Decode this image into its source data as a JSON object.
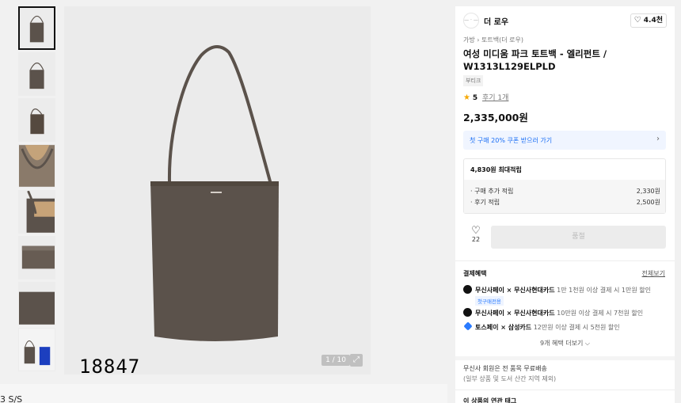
{
  "gallery": {
    "counter": "1 / 10",
    "expand_icon": "expand-icon",
    "watermark": "18847",
    "thumbnail_count": 8,
    "bag_color": "#5b524b"
  },
  "footer_strip": {
    "text": "3 S/S"
  },
  "brand": {
    "logo_text": "— · —",
    "name": "더 로우",
    "like_icon": "heart-icon",
    "like_count": "4.4천"
  },
  "product": {
    "breadcrumb": "가방 › 토트백(더 로우)",
    "title": "여성 미디움 파크 토트백 - 엘리펀트 / W1313L129ELPLD",
    "tag": "부티크",
    "rating_score": "5",
    "rating_reviews": "후기 1개",
    "price": "2,335,000원"
  },
  "coupon": {
    "label": "첫 구매 20% 쿠폰 받으러 가기",
    "chevron_icon": "chevron-right-icon"
  },
  "points": {
    "title": "4,830원 최대적립",
    "rows": [
      {
        "label": "· 구매 추가 적립",
        "value": "2,330원"
      },
      {
        "label": "· 후기 적립",
        "value": "2,500원"
      }
    ]
  },
  "purchase": {
    "wish_count": "22",
    "buy_label": "품절"
  },
  "benefits": {
    "title": "결제혜택",
    "view_all": "전체보기",
    "items": [
      {
        "strong": "무신사페이 × 무신사현대카드",
        "desc": " 1만 1천원 이상 결제 시 1만원 할인",
        "badge": "첫구매전용"
      },
      {
        "strong": "무신사페이 × 무신사현대카드",
        "desc": " 10만원 이상 결제 시 7천원 할인",
        "badge": ""
      },
      {
        "strong": "토스페이 × 삼성카드",
        "desc": " 12만원 이상 결제 시 5천원 할인",
        "badge": ""
      }
    ],
    "more": "9개 혜택 더보기 ⌵"
  },
  "shipping": {
    "line1": "무신사 회원은 전 품목 무료배송",
    "line2": "(일부 상품 및 도서 산간 지역 제외)"
  },
  "related": {
    "title": "이 상품의 연관 태그"
  }
}
